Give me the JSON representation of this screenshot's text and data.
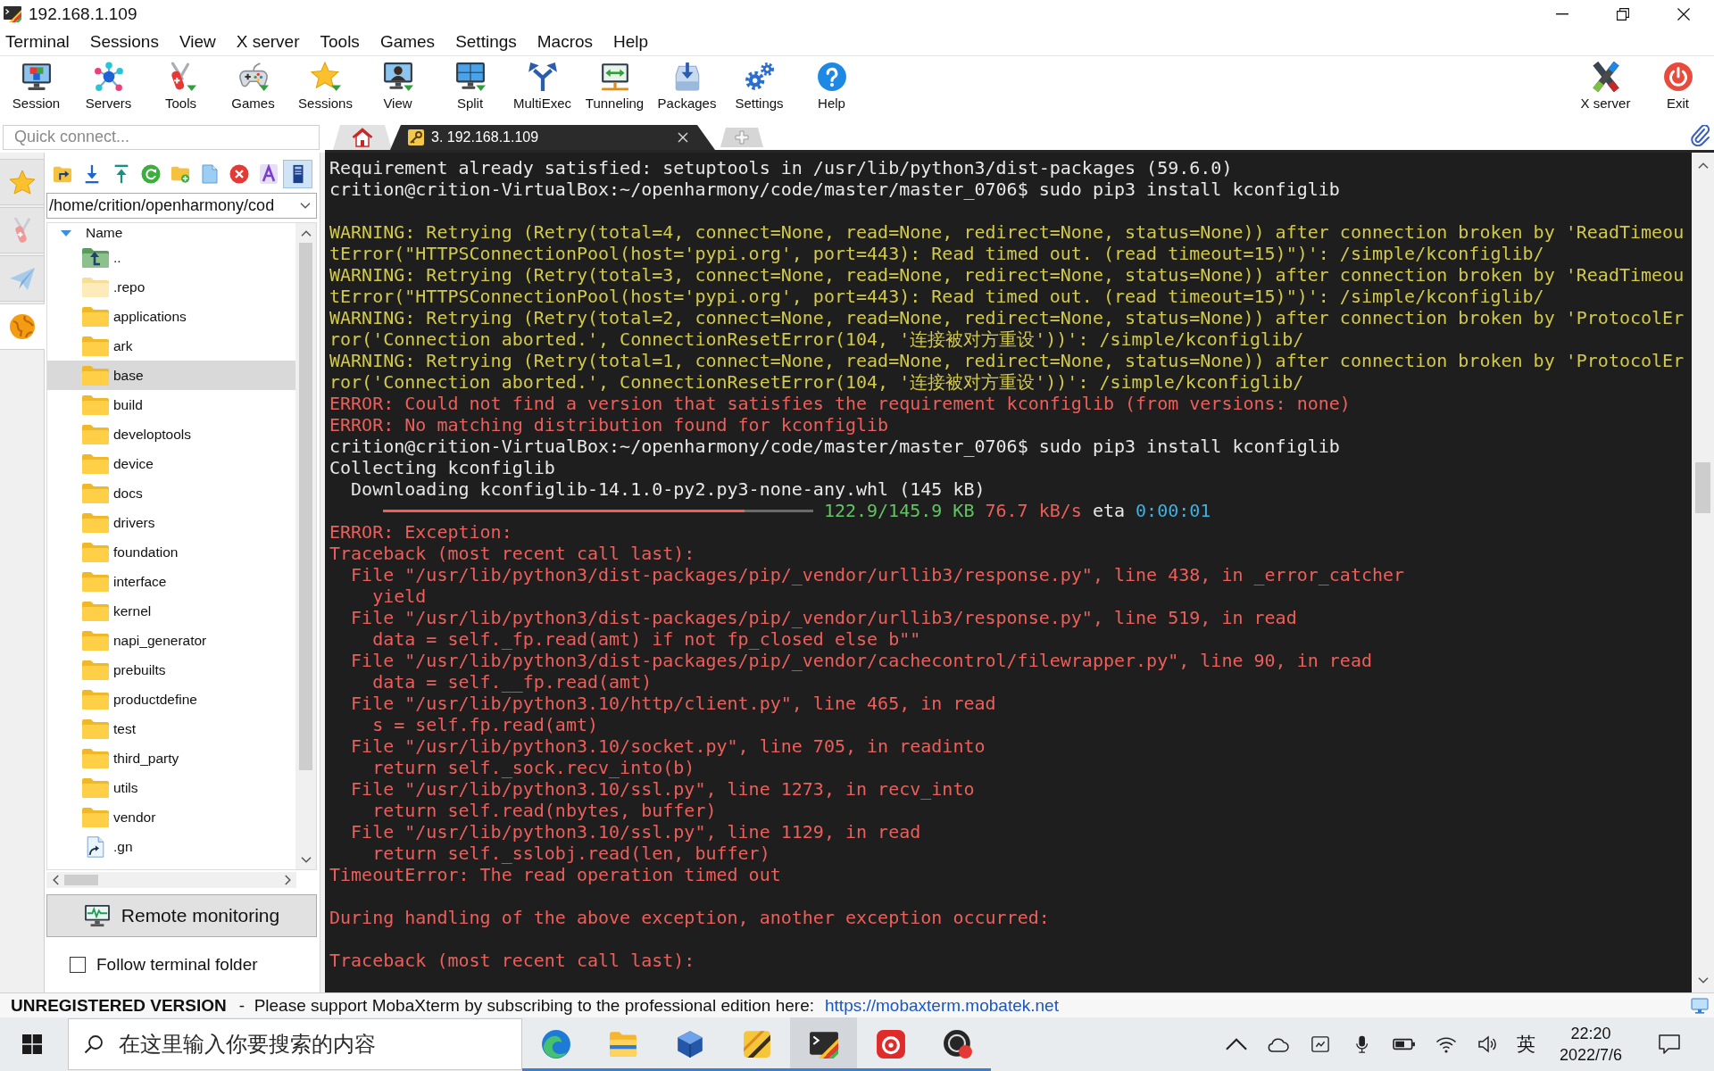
{
  "window": {
    "title": "192.168.1.109"
  },
  "menu": [
    "Terminal",
    "Sessions",
    "View",
    "X server",
    "Tools",
    "Games",
    "Settings",
    "Macros",
    "Help"
  ],
  "toolbar": {
    "left": [
      {
        "kind": "session",
        "label": "Session"
      },
      {
        "kind": "servers",
        "label": "Servers"
      },
      {
        "kind": "tools",
        "label": "Tools"
      },
      {
        "kind": "games",
        "label": "Games"
      },
      {
        "kind": "sessions",
        "label": "Sessions"
      },
      {
        "kind": "view",
        "label": "View"
      },
      {
        "kind": "split",
        "label": "Split"
      },
      {
        "kind": "multiexec",
        "label": "MultiExec"
      },
      {
        "kind": "tunneling",
        "label": "Tunneling"
      },
      {
        "kind": "packages",
        "label": "Packages"
      },
      {
        "kind": "settings",
        "label": "Settings"
      },
      {
        "kind": "help",
        "label": "Help"
      }
    ],
    "right": [
      {
        "kind": "xserver",
        "label": "X server"
      },
      {
        "kind": "exit",
        "label": "Exit"
      }
    ]
  },
  "quick_connect": {
    "placeholder": "Quick connect..."
  },
  "tabs": [
    {
      "kind": "home",
      "selected": false
    },
    {
      "kind": "session",
      "label": "3. 192.168.1.109",
      "selected": true
    },
    {
      "kind": "new",
      "selected": false
    }
  ],
  "side_tabs": [
    {
      "kind": "sessions",
      "selected": false
    },
    {
      "kind": "tools",
      "selected": false
    },
    {
      "kind": "macros",
      "selected": false
    },
    {
      "kind": "sftp",
      "selected": true
    }
  ],
  "sftp": {
    "toolbar": [
      {
        "kind": "parent-folder",
        "pressed": false
      },
      {
        "kind": "download",
        "pressed": false
      },
      {
        "kind": "upload",
        "pressed": false
      },
      {
        "kind": "refresh",
        "pressed": false
      },
      {
        "kind": "new-folder",
        "pressed": false
      },
      {
        "kind": "new-file",
        "pressed": false
      },
      {
        "kind": "delete",
        "pressed": false
      },
      {
        "kind": "rename",
        "pressed": false
      },
      {
        "kind": "panel",
        "pressed": true
      }
    ],
    "path": "/home/crition/openharmony/cod",
    "column": "Name",
    "files": [
      {
        "name": "..",
        "kind": "parent",
        "selected": false
      },
      {
        "name": ".repo",
        "kind": "hidden-folder",
        "selected": false
      },
      {
        "name": "applications",
        "kind": "folder",
        "selected": false
      },
      {
        "name": "ark",
        "kind": "folder",
        "selected": false
      },
      {
        "name": "base",
        "kind": "folder",
        "selected": true
      },
      {
        "name": "build",
        "kind": "folder",
        "selected": false
      },
      {
        "name": "developtools",
        "kind": "folder",
        "selected": false
      },
      {
        "name": "device",
        "kind": "folder",
        "selected": false
      },
      {
        "name": "docs",
        "kind": "folder",
        "selected": false
      },
      {
        "name": "drivers",
        "kind": "folder",
        "selected": false
      },
      {
        "name": "foundation",
        "kind": "folder",
        "selected": false
      },
      {
        "name": "interface",
        "kind": "folder",
        "selected": false
      },
      {
        "name": "kernel",
        "kind": "folder",
        "selected": false
      },
      {
        "name": "napi_generator",
        "kind": "folder",
        "selected": false
      },
      {
        "name": "prebuilts",
        "kind": "folder",
        "selected": false
      },
      {
        "name": "productdefine",
        "kind": "folder",
        "selected": false
      },
      {
        "name": "test",
        "kind": "folder",
        "selected": false
      },
      {
        "name": "third_party",
        "kind": "folder",
        "selected": false
      },
      {
        "name": "utils",
        "kind": "folder",
        "selected": false
      },
      {
        "name": "vendor",
        "kind": "folder",
        "selected": false
      },
      {
        "name": ".gn",
        "kind": "symlink",
        "selected": false
      }
    ],
    "remote_monitoring": "Remote monitoring",
    "follow_terminal_folder": {
      "label": "Follow terminal folder",
      "checked": false
    }
  },
  "terminal": {
    "lines": [
      {
        "kind": "output",
        "text": "Requirement already satisfied: setuptools in /usr/lib/python3/dist-packages (59.6.0)"
      },
      {
        "kind": "prompt",
        "text": "crition@crition-VirtualBox:~/openharmony/code/master/master_0706$ sudo pip3 install kconfiglib"
      },
      {
        "kind": "blank"
      },
      {
        "kind": "warning",
        "text": "WARNING: Retrying (Retry(total=4, connect=None, read=None, redirect=None, status=None)) after connection broken by 'ReadTimeou"
      },
      {
        "kind": "warning",
        "text": "tError(\"HTTPSConnectionPool(host='pypi.org', port=443): Read timed out. (read timeout=15)\")': /simple/kconfiglib/"
      },
      {
        "kind": "warning",
        "text": "WARNING: Retrying (Retry(total=3, connect=None, read=None, redirect=None, status=None)) after connection broken by 'ReadTimeou"
      },
      {
        "kind": "warning",
        "text": "tError(\"HTTPSConnectionPool(host='pypi.org', port=443): Read timed out. (read timeout=15)\")': /simple/kconfiglib/"
      },
      {
        "kind": "warning",
        "text": "WARNING: Retrying (Retry(total=2, connect=None, read=None, redirect=None, status=None)) after connection broken by 'ProtocolEr"
      },
      {
        "kind": "warning",
        "text": "ror('Connection aborted.', ConnectionResetError(104, '连接被对方重设'))': /simple/kconfiglib/"
      },
      {
        "kind": "warning",
        "text": "WARNING: Retrying (Retry(total=1, connect=None, read=None, redirect=None, status=None)) after connection broken by 'ProtocolEr"
      },
      {
        "kind": "warning",
        "text": "ror('Connection aborted.', ConnectionResetError(104, '连接被对方重设'))': /simple/kconfiglib/"
      },
      {
        "kind": "error",
        "text": "ERROR: Could not find a version that satisfies the requirement kconfiglib (from versions: none)"
      },
      {
        "kind": "error",
        "text": "ERROR: No matching distribution found for kconfiglib"
      },
      {
        "kind": "prompt",
        "text": "crition@crition-VirtualBox:~/openharmony/code/master/master_0706$ sudo pip3 install kconfiglib"
      },
      {
        "kind": "output",
        "text": "Collecting kconfiglib"
      },
      {
        "kind": "download",
        "text": "Downloading kconfiglib-14.1.0-py2.py3-none-any.whl (145 kB)"
      },
      {
        "kind": "progress",
        "level": 0.84,
        "size": "122.9/145.9 KB",
        "speed": "76.7 kB/s",
        "eta_label": "eta",
        "eta": "0:00:01"
      },
      {
        "kind": "error",
        "text": "ERROR: Exception:"
      },
      {
        "kind": "error",
        "text": "Traceback (most recent call last):"
      },
      {
        "kind": "trace-file",
        "text": "File \"/usr/lib/python3/dist-packages/pip/_vendor/urllib3/response.py\", line 438, in _error_catcher"
      },
      {
        "kind": "trace-code",
        "text": "yield"
      },
      {
        "kind": "trace-file",
        "text": "File \"/usr/lib/python3/dist-packages/pip/_vendor/urllib3/response.py\", line 519, in read"
      },
      {
        "kind": "trace-code",
        "text": "data = self._fp.read(amt) if not fp_closed else b\"\""
      },
      {
        "kind": "trace-file",
        "text": "File \"/usr/lib/python3/dist-packages/pip/_vendor/cachecontrol/filewrapper.py\", line 90, in read"
      },
      {
        "kind": "trace-code",
        "text": "data = self.__fp.read(amt)"
      },
      {
        "kind": "trace-file",
        "text": "File \"/usr/lib/python3.10/http/client.py\", line 465, in read"
      },
      {
        "kind": "trace-code",
        "text": "s = self.fp.read(amt)"
      },
      {
        "kind": "trace-file",
        "text": "File \"/usr/lib/python3.10/socket.py\", line 705, in readinto"
      },
      {
        "kind": "trace-code",
        "text": "return self._sock.recv_into(b)"
      },
      {
        "kind": "trace-file",
        "text": "File \"/usr/lib/python3.10/ssl.py\", line 1273, in recv_into"
      },
      {
        "kind": "trace-code",
        "text": "return self.read(nbytes, buffer)"
      },
      {
        "kind": "trace-file",
        "text": "File \"/usr/lib/python3.10/ssl.py\", line 1129, in read"
      },
      {
        "kind": "trace-code",
        "text": "return self._sslobj.read(len, buffer)"
      },
      {
        "kind": "error",
        "text": "TimeoutError: The read operation timed out"
      },
      {
        "kind": "blank"
      },
      {
        "kind": "error",
        "text": "During handling of the above exception, another exception occurred:"
      },
      {
        "kind": "blank"
      },
      {
        "kind": "error",
        "text": "Traceback (most recent call last):"
      }
    ]
  },
  "status_bar": {
    "notice": "UNREGISTERED VERSION",
    "message": "-  Please support MobaXterm by subscribing to the professional edition here:",
    "link": "https://mobaxterm.mobatek.net"
  },
  "taskbar": {
    "search": {
      "placeholder": "在这里输入你要搜索的内容"
    },
    "apps": [
      {
        "kind": "browser",
        "running": true,
        "selected": false
      },
      {
        "kind": "files",
        "running": true,
        "selected": false
      },
      {
        "kind": "virtualbox",
        "running": true,
        "selected": false
      },
      {
        "kind": "app",
        "running": true,
        "selected": false
      },
      {
        "kind": "terminal",
        "running": true,
        "selected": true
      },
      {
        "kind": "music",
        "running": true,
        "selected": false
      },
      {
        "kind": "recorder",
        "running": true,
        "selected": false
      }
    ],
    "ime": "英",
    "time": "22:20",
    "date": "2022/7/6"
  }
}
